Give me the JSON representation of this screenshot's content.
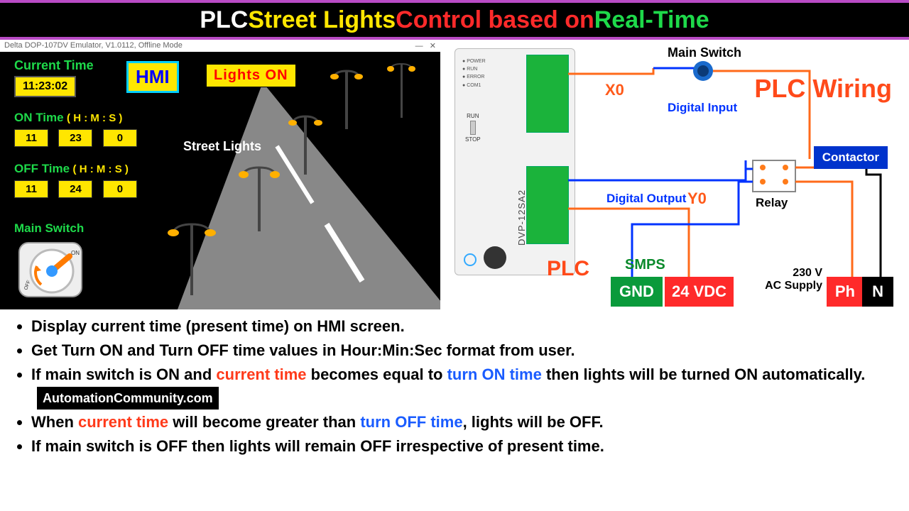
{
  "title": {
    "p1": "PLC ",
    "p2": "Street Lights ",
    "p3": "Control based on ",
    "p4": "Real-Time"
  },
  "hmi": {
    "window_title": "Delta DOP-107DV Emulator, V1.0112, Offline Mode",
    "badge": "HMI",
    "status": "Lights ON",
    "current_time_label": "Current Time",
    "current_time": "11:23:02",
    "on_time_label": "ON Time",
    "off_time_label": "OFF Time",
    "hms": "( H : M : S )",
    "on_time": {
      "h": "11",
      "m": "23",
      "s": "0"
    },
    "off_time": {
      "h": "11",
      "m": "24",
      "s": "0"
    },
    "main_switch_label": "Main Switch",
    "switch_on": "ON",
    "switch_off": "OFF",
    "street_label": "Street Lights"
  },
  "wiring": {
    "title": "PLC Wiring",
    "plc_label": "PLC",
    "plc_model": "DVP-12SA2",
    "main_switch": "Main Switch",
    "digital_input": "Digital Input",
    "digital_output": "Digital Output",
    "x0": "X0",
    "y0": "Y0",
    "relay": "Relay",
    "contactor": "Contactor",
    "smps": "SMPS",
    "gnd": "GND",
    "vdc": "24 VDC",
    "ac_supply_v": "230 V",
    "ac_supply_l": "AC Supply",
    "ph": "Ph",
    "n": "N",
    "leds": [
      "POWER",
      "RUN",
      "ERROR",
      "COM1"
    ],
    "run": "RUN",
    "stop": "STOP"
  },
  "bullets": {
    "b1": "Display current time (present time) on HMI screen.",
    "b2": "Get Turn ON and Turn OFF time values in Hour:Min:Sec format from user.",
    "b3a": "If main switch is ON and ",
    "b3b": "current time",
    "b3c": " becomes equal to ",
    "b3d": "turn ON time",
    "b3e": " then lights will be turned ON automatically.",
    "b4a": "When ",
    "b4b": "current time",
    "b4c": " will become greater than ",
    "b4d": "turn OFF time",
    "b4e": ", lights will be OFF.",
    "b5": "If main switch is OFF then lights will remain OFF irrespective of present time."
  },
  "watermark": "AutomationCommunity.com"
}
